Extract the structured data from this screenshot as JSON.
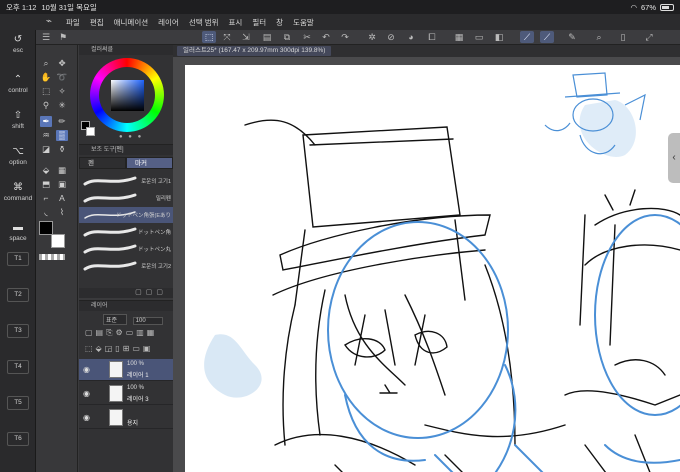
{
  "status_bar": {
    "time": "오후 1:12",
    "date": "10월 31일 목요일",
    "battery": "67%",
    "battery_level": 0.67
  },
  "menu": [
    "파일",
    "편집",
    "애니메이션",
    "레이어",
    "선택 범위",
    "표시",
    "필터",
    "창",
    "도움말"
  ],
  "shortcuts": [
    {
      "icon": "↺",
      "label": "esc"
    },
    {
      "icon": "⌃",
      "label": "control"
    },
    {
      "icon": "⇧",
      "label": "shift"
    },
    {
      "icon": "⌥",
      "label": "option"
    },
    {
      "icon": "⌘",
      "label": "command"
    },
    {
      "icon": "▬",
      "label": "space"
    },
    {
      "label": "T1"
    },
    {
      "label": "T2"
    },
    {
      "label": "T3"
    },
    {
      "label": "T4"
    },
    {
      "label": "T5"
    },
    {
      "label": "T6"
    }
  ],
  "color_panel": {
    "title": "컬러써클"
  },
  "sub_tool": {
    "title": "보조 도구[펜]",
    "tabs": [
      "펜",
      "마커"
    ],
    "brushes": [
      {
        "label": "로운의 고기1"
      },
      {
        "label": "밀리펜"
      },
      {
        "label": "ドットペン角張(Eあり"
      },
      {
        "label": "ドットペン角"
      },
      {
        "label": "ドットペン丸"
      },
      {
        "label": "로운의 고기2"
      }
    ],
    "selected_index": 2
  },
  "layer_panel": {
    "title": "레이어",
    "blend_mode": "표준",
    "opacity": "100",
    "layers": [
      {
        "percent": "100 %",
        "name": "레이어 1",
        "selected": true
      },
      {
        "percent": "100 %",
        "name": "레이어 3",
        "selected": false
      },
      {
        "percent": "",
        "name": "용지",
        "selected": false
      }
    ]
  },
  "document": {
    "tab_title": "일러스트25* (167.47 x 209.97mm 300dpi 139.8%)"
  },
  "colors": {
    "accent": "#5a76b8",
    "sketch_blue": "#4a8fd6",
    "sketch_black": "#111111"
  }
}
